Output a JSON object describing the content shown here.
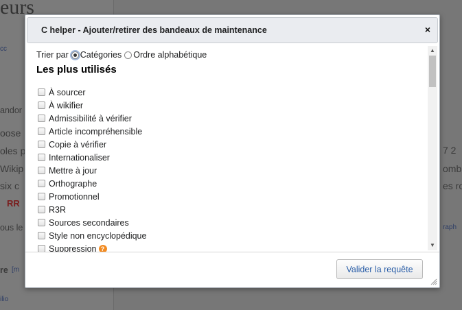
{
  "background": {
    "title_fragment": "eurs",
    "line_fragments": [
      "cc",
      "andor",
      "oose",
      "oles p",
      "Wikip",
      "six c",
      "RR",
      "ous le",
      "re"
    ],
    "right_fragments": [
      "7 2",
      "omb",
      "es ro"
    ],
    "link_fragments": [
      "[m",
      "ilio",
      "raph"
    ]
  },
  "dialog": {
    "title": "C helper - Ajouter/retirer des bandeaux de maintenance",
    "close_label": "×",
    "sort": {
      "label": "Trier par",
      "options": [
        {
          "label": "Catégories",
          "selected": true
        },
        {
          "label": "Ordre alphabétique",
          "selected": false
        }
      ]
    },
    "section_title": "Les plus utilisés",
    "items": [
      {
        "label": "À sourcer"
      },
      {
        "label": "À wikifier"
      },
      {
        "label": "Admissibilité à vérifier"
      },
      {
        "label": "Article incompréhensible"
      },
      {
        "label": "Copie à vérifier"
      },
      {
        "label": "Internationaliser"
      },
      {
        "label": "Mettre à jour"
      },
      {
        "label": "Orthographe"
      },
      {
        "label": "Promotionnel"
      },
      {
        "label": "R3R"
      },
      {
        "label": "Sources secondaires"
      },
      {
        "label": "Style non encyclopédique"
      },
      {
        "label": "Suppression",
        "help": "?"
      }
    ],
    "submit_label": "Valider la requête",
    "scroll_up": "▲",
    "scroll_down": "▼"
  }
}
